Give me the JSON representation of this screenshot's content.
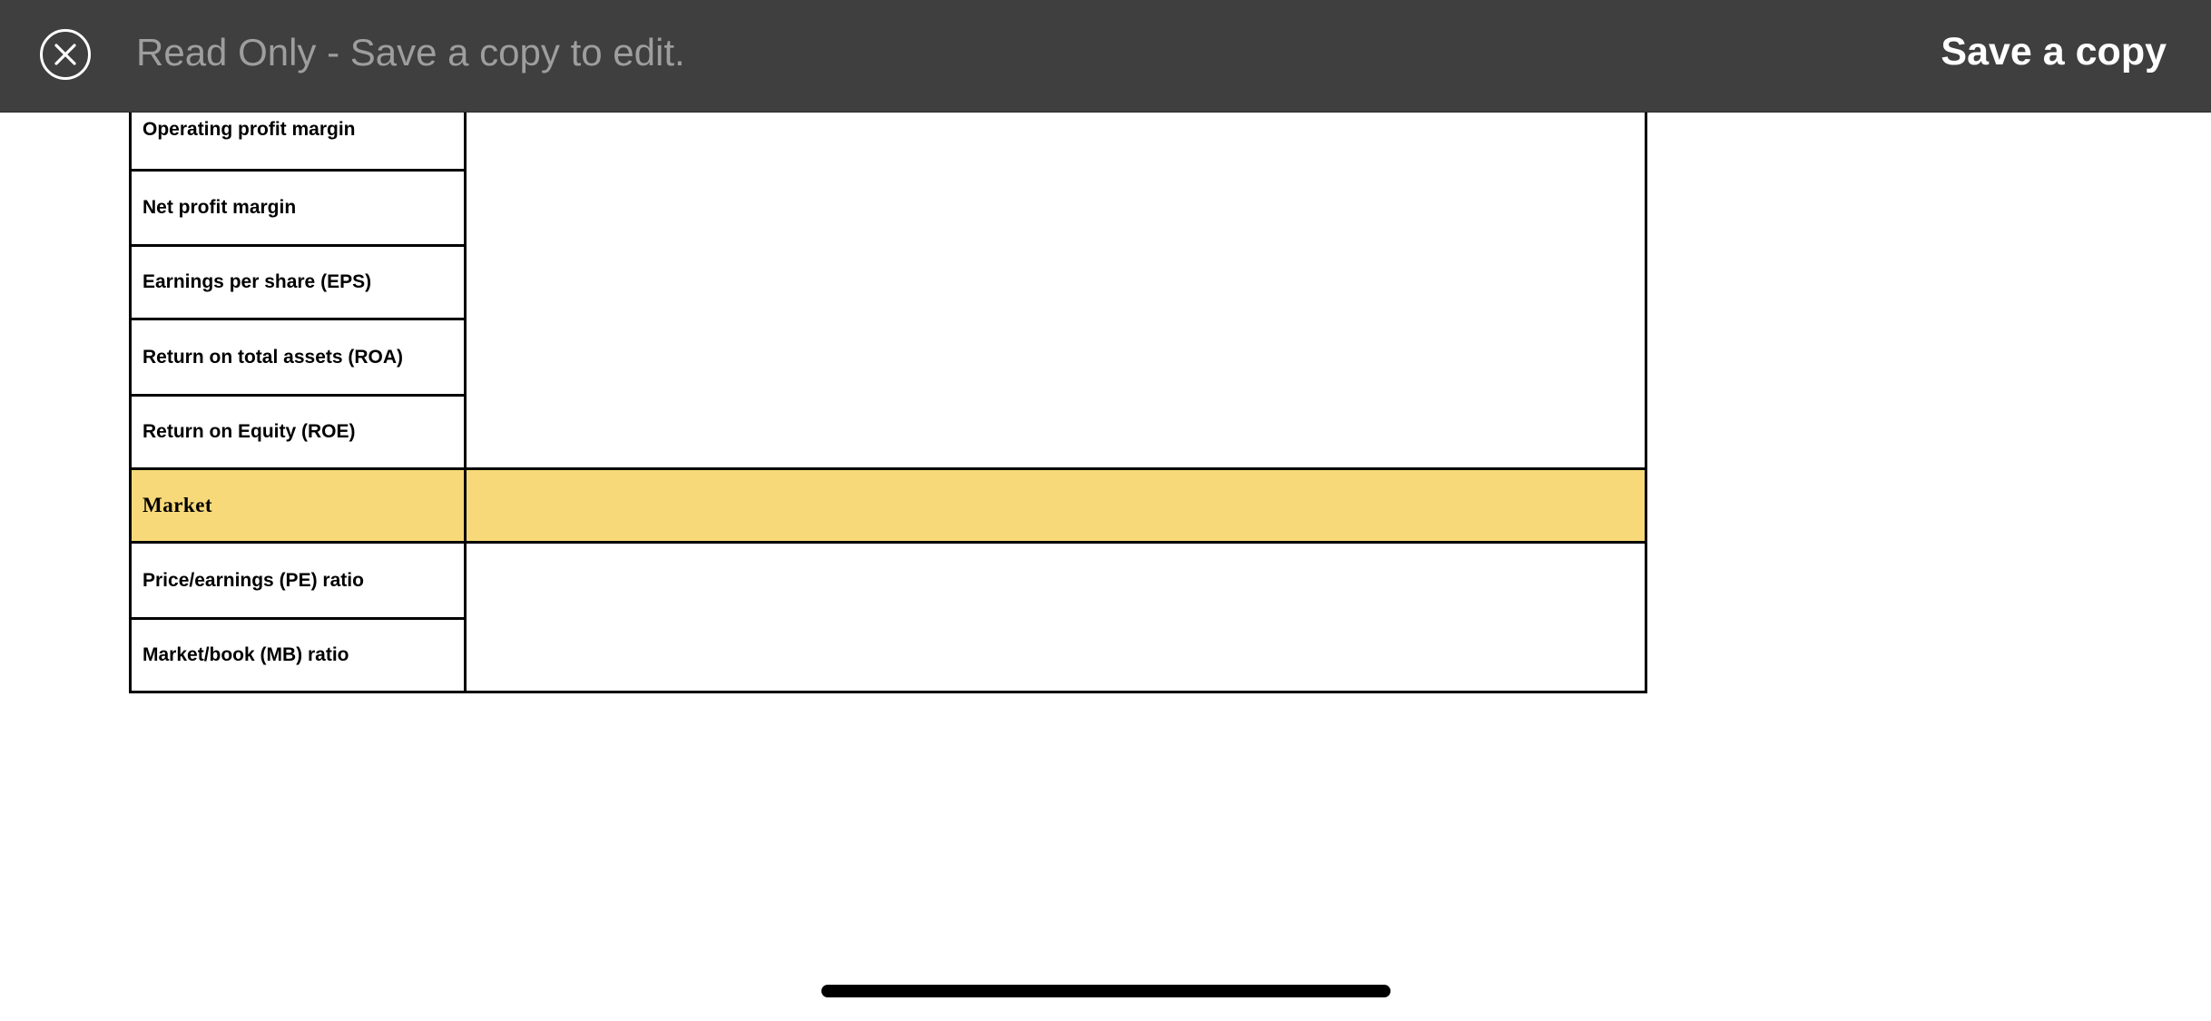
{
  "header": {
    "read_only_message": "Read Only - Save a copy to edit.",
    "save_copy_label": "Save a copy",
    "close_icon": "close-circle-icon",
    "background_color": "#3f3f3f"
  },
  "table": {
    "rows": [
      {
        "label": "Operating profit margin",
        "section": false
      },
      {
        "label": "Net profit margin",
        "section": false
      },
      {
        "label": "Earnings per share (EPS)",
        "section": false
      },
      {
        "label": "Return on total assets (ROA)",
        "section": false
      },
      {
        "label": "Return on Equity (ROE)",
        "section": false
      },
      {
        "label": "Market",
        "section": true
      },
      {
        "label": "Price/earnings (PE) ratio",
        "section": false
      },
      {
        "label": "Market/book (MB) ratio",
        "section": false
      }
    ],
    "section_fill_color": "#f8d979"
  }
}
